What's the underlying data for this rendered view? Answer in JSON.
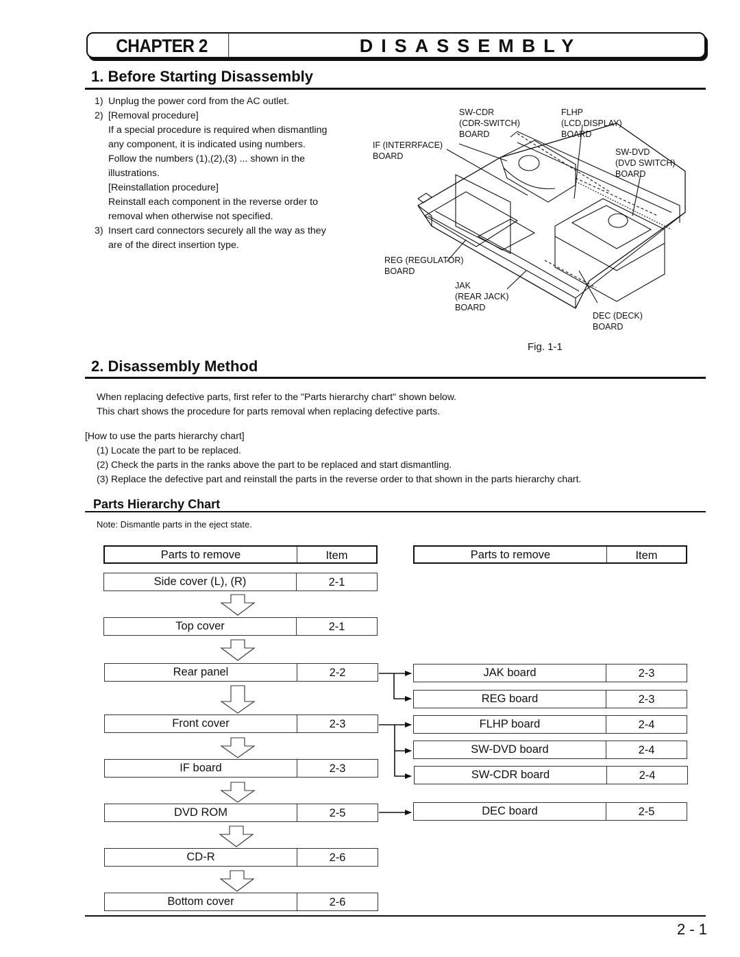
{
  "header": {
    "chapter_label": "CHAPTER 2",
    "chapter_title": "DISASSEMBLY"
  },
  "section1": {
    "heading": "1. Before Starting Disassembly",
    "steps": [
      {
        "num": "1)",
        "lines": [
          "Unplug the power cord from the AC outlet."
        ]
      },
      {
        "num": "2)",
        "lines": [
          "[Removal procedure]"
        ]
      },
      {
        "num": "",
        "lines": [
          "If a special procedure is required when dismantling",
          "any component, it is indicated using numbers.",
          "Follow the numbers (1),(2),(3) ... shown in the",
          "illustrations.",
          "[Reinstallation procedure]",
          "Reinstall each component in the reverse order to",
          "removal when otherwise not specified."
        ]
      },
      {
        "num": "3)",
        "lines": [
          "Insert card connectors securely all the way as they",
          "are of the direct insertion type."
        ]
      }
    ],
    "figure": {
      "caption": "Fig. 1-1",
      "labels": {
        "sw_cdr": [
          "SW-CDR",
          "(CDR-SWITCH)",
          "BOARD"
        ],
        "flhp": [
          "FLHP",
          "(LCD DISPLAY)",
          "BOARD"
        ],
        "if": [
          "IF (INTERRFACE)",
          "BOARD"
        ],
        "sw_dvd": [
          "SW-DVD",
          "(DVD SWITCH)",
          "BOARD"
        ],
        "reg": [
          "REG (REGULATOR)",
          "BOARD"
        ],
        "jak": [
          "JAK",
          "(REAR JACK)",
          "BOARD"
        ],
        "dec": [
          "DEC (DECK)",
          "BOARD"
        ]
      }
    }
  },
  "section2": {
    "heading": "2. Disassembly Method",
    "intro": [
      "When replacing defective parts, first refer to the \"Parts hierarchy chart\" shown below.",
      "This chart shows the procedure for parts removal when replacing defective parts."
    ],
    "howto_title": "[How to use the parts hierarchy chart]",
    "howto": [
      "(1) Locate the part to be replaced.",
      "(2) Check the parts in the ranks above the part to be replaced and start dismantling.",
      "(3) Replace the defective part and reinstall the parts in the reverse order to that shown in the parts hierarchy chart."
    ]
  },
  "chart": {
    "heading": "Parts Hierarchy Chart",
    "note": "Note: Dismantle parts in the eject state.",
    "col_parts": "Parts to remove",
    "col_item": "Item",
    "main": [
      {
        "part": "Side cover (L), (R)",
        "item": "2-1"
      },
      {
        "part": "Top cover",
        "item": "2-1"
      },
      {
        "part": "Rear panel",
        "item": "2-2"
      },
      {
        "part": "Front cover",
        "item": "2-3"
      },
      {
        "part": "IF board",
        "item": "2-3"
      },
      {
        "part": "DVD ROM",
        "item": "2-5"
      },
      {
        "part": "CD-R",
        "item": "2-6"
      },
      {
        "part": "Bottom cover",
        "item": "2-6"
      }
    ],
    "branches": [
      {
        "part": "JAK board",
        "item": "2-3",
        "parent": "Rear panel"
      },
      {
        "part": "REG board",
        "item": "2-3",
        "parent": "Rear panel"
      },
      {
        "part": "FLHP board",
        "item": "2-4",
        "parent": "Front cover"
      },
      {
        "part": "SW-DVD board",
        "item": "2-4",
        "parent": "Front cover"
      },
      {
        "part": "SW-CDR board",
        "item": "2-4",
        "parent": "Front cover"
      },
      {
        "part": "DEC board",
        "item": "2-5",
        "parent": "DVD ROM"
      }
    ]
  },
  "footer": {
    "page_number": "2 - 1"
  }
}
